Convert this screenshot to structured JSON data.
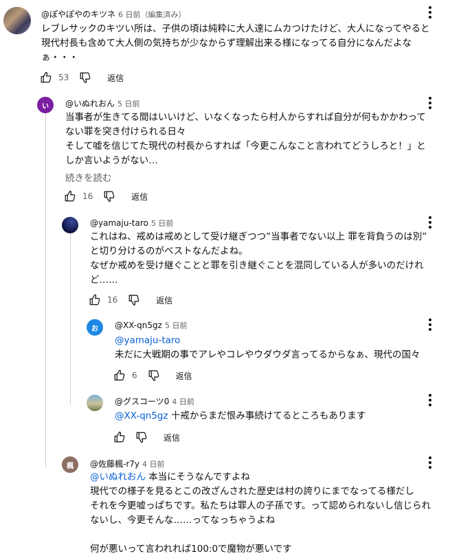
{
  "comments": [
    {
      "author": "@ぽやぽやのキツネ",
      "time": "6 日前（編集済み）",
      "lines": [
        "レブレサックのキツい所は、子供の頃は純粋に大人達にムカつけたけど、大人になってやると",
        "現代村長も含めて大人側の気持ちが少なからず理解出来る様になってる自分になんだよな",
        "ぁ・・・"
      ],
      "likes": "53",
      "reply": "返信"
    },
    {
      "author": "@いぬれおん",
      "time": "5 日前",
      "avatar_letter": "い",
      "lines": [
        "当事者が生きてる間はいいけど、いなくなったら村人からすれば自分が何もかかわって",
        "ない罪を突き付けられる日々",
        "そして嘘を信じてた現代の村長からすれば「今更こんなこと言われてどうしろと！」と",
        "しか言いようがない…"
      ],
      "read_more": "続きを読む",
      "likes": "16",
      "reply": "返信"
    },
    {
      "author": "@yamaju-taro",
      "time": "5 日前",
      "lines": [
        "これはね、戒めは戒めとして受け継ぎつつ”当事者でない以上 罪を背負うのは別”",
        "と切り分けるのがベストなんだよね。",
        "なぜか戒めを受け継ぐことと罪を引き継ぐことを混同している人が多いのだけれ",
        "ど……"
      ],
      "likes": "16",
      "reply": "返信"
    },
    {
      "author": "@XX-qn5gz",
      "time": "5 日前",
      "avatar_letter": "お",
      "mention": "@yamaju-taro",
      "lines": [
        "未だに大戦期の事でアレやコレやウダウダ言ってるからなぁ、現代の国々"
      ],
      "likes": "6",
      "reply": "返信"
    },
    {
      "author": "@グスコーツ0",
      "time": "4 日前",
      "mention": "@XX-qn5gz",
      "inline_text": " 十戒からまだ恨み事続けてるところもあります",
      "reply": "返信"
    },
    {
      "author": "@佐藤楓-r7y",
      "time": "4 日前",
      "avatar_letter": "楓",
      "mention": "@いぬれおん",
      "inline_text": " 本当にそうなんですよね",
      "lines": [
        "現代での様子を見るとこの改ざんされた歴史は村の誇りにまでなってる様だし",
        "それを今更嘘っぱちです。私たちは罪人の子孫です。って認められないし信じられ",
        "ないし、今更そんな……ってなっちゃうよね",
        "",
        "何が悪いって言われれば100:0で魔物が悪いです"
      ]
    }
  ]
}
